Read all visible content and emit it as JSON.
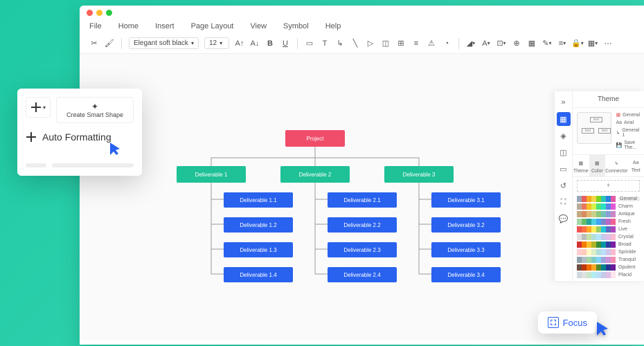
{
  "menu": {
    "file": "File",
    "home": "Home",
    "insert": "Insert",
    "page": "Page Layout",
    "view": "View",
    "symbol": "Symbol",
    "help": "Help"
  },
  "toolbar": {
    "font": "Elegant soft black",
    "size": "12"
  },
  "chart": {
    "root": "Project",
    "d1": {
      "label": "Deliverable 1",
      "items": [
        "Deliverable 1.1",
        "Deliverable 1.2",
        "Deliverable 1.3",
        "Deliverable 1.4"
      ]
    },
    "d2": {
      "label": "Deliverable 2",
      "items": [
        "Deliverable 2.1",
        "Deliverable 2.2",
        "Deliverable 2.3",
        "Deliverable 2.4"
      ]
    },
    "d3": {
      "label": "Deliverable 3",
      "items": [
        "Deliverable 3.1",
        "Deliverable 3.2",
        "Deliverable 3.3",
        "Deliverable 3.4"
      ]
    }
  },
  "popup": {
    "smart": "Create Smart Shape",
    "auto": "Auto Formatting"
  },
  "theme": {
    "title": "Theme",
    "opt_general": "General",
    "opt_arial": "Arial",
    "opt_general1": "General 1",
    "opt_save": "Save The...",
    "tab_theme": "Theme",
    "tab_color": "Color",
    "tab_connector": "Connector",
    "tab_text": "Text",
    "palettes": [
      "General",
      "Charm",
      "Antique",
      "Fresh",
      "Live",
      "Crystal",
      "Broad",
      "Sprinkle",
      "Tranquil",
      "Opulent",
      "Placid"
    ],
    "colors": [
      [
        "#9aa5b8",
        "#e85d5d",
        "#f5a623",
        "#f1d749",
        "#7ed321",
        "#2ec4b6",
        "#2c82e0",
        "#e25aa5"
      ],
      [
        "#b8a99a",
        "#e8785d",
        "#f5c023",
        "#d4f149",
        "#49e37e",
        "#2ee0c4",
        "#5d82e8",
        "#e25ad4"
      ],
      [
        "#c4a97d",
        "#d88b5e",
        "#e0b873",
        "#c9d089",
        "#8cc97d",
        "#73c4b8",
        "#8b9ed8",
        "#c987c4"
      ],
      [
        "#a5d6a7",
        "#66bb6a",
        "#26a69a",
        "#4dd0e1",
        "#42a5f5",
        "#7986cb",
        "#ba68c8",
        "#f06292"
      ],
      [
        "#ef5350",
        "#ff7043",
        "#ffa726",
        "#ffee58",
        "#9ccc65",
        "#26c6da",
        "#5c6bc0",
        "#ab47bc"
      ],
      [
        "#e0e0e0",
        "#bdbdbd",
        "#c5e1a5",
        "#b2dfdb",
        "#b3e5fc",
        "#c5cae9",
        "#e1bee7",
        "#f8bbd0"
      ],
      [
        "#d32f2f",
        "#f57c00",
        "#fbc02d",
        "#afb42b",
        "#388e3c",
        "#0097a7",
        "#303f9f",
        "#7b1fa2"
      ],
      [
        "#ffcdd2",
        "#ffccbc",
        "#fff9c4",
        "#dcedc8",
        "#b2dfdb",
        "#bbdefb",
        "#d1c4e9",
        "#f8bbd0"
      ],
      [
        "#90a4ae",
        "#b0bec5",
        "#a5d6a7",
        "#80cbc4",
        "#81d4fa",
        "#9fa8da",
        "#ce93d8",
        "#f48fb1"
      ],
      [
        "#6d4c41",
        "#bf360c",
        "#ef6c00",
        "#f9a825",
        "#558b2f",
        "#00838f",
        "#283593",
        "#6a1b9a"
      ],
      [
        "#cfd8dc",
        "#e0e0e0",
        "#c8e6c9",
        "#b2ebf2",
        "#bbdefb",
        "#c5cae9",
        "#e1bee7",
        "#fce4ec"
      ]
    ]
  },
  "focus": "Focus"
}
